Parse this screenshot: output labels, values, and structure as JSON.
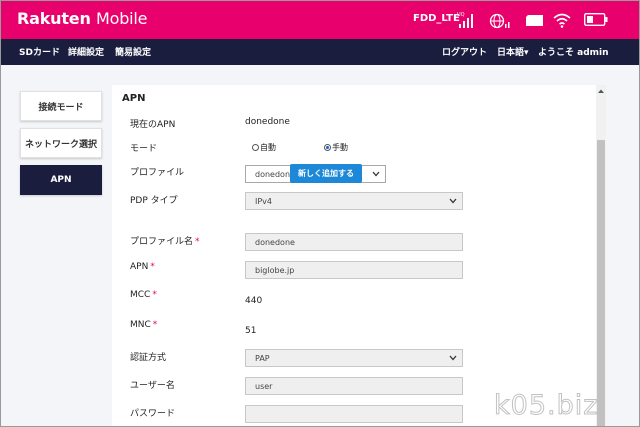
{
  "colors": {
    "brand": "#e8006d",
    "nav": "#1b1d3f",
    "accent_button": "#1e88d8",
    "required_mark": "#e8006d"
  },
  "header": {
    "logo_brand": "Rakuten",
    "logo_product": "Mobile",
    "network_status": "FDD_LTE",
    "icons": [
      "signal-bars-icon",
      "roaming-globe-icon",
      "sim-card-icon",
      "wifi-icon",
      "battery-icon"
    ]
  },
  "nav": {
    "sd_card": "SDカード",
    "advanced": "詳細設定",
    "basic": "簡易設定",
    "logout": "ログアウト",
    "language": "日本語▾",
    "welcome": "ようこそ admin"
  },
  "sidebar": {
    "items": [
      {
        "label": "接続モード",
        "active": false
      },
      {
        "label": "ネットワーク選択",
        "active": false
      },
      {
        "label": "APN",
        "active": true
      }
    ]
  },
  "apn": {
    "title": "APN",
    "current_apn_label": "現在のAPN",
    "current_apn_value": "donedone",
    "mode_label": "モード",
    "mode_auto": "自動",
    "mode_manual": "手動",
    "mode_selected": "manual",
    "profile_label": "プロファイル",
    "profile_value": "donedone",
    "add_new_button": "新しく追加する",
    "pdp_type_label": "PDP タイプ",
    "pdp_type_value": "IPv4",
    "profile_name_label": "プロファイル名",
    "profile_name_value": "donedone",
    "apn_label": "APN",
    "apn_value": "biglobe.jp",
    "mcc_label": "MCC",
    "mcc_value": "440",
    "mnc_label": "MNC",
    "mnc_value": "51",
    "auth_label": "認証方式",
    "auth_value": "PAP",
    "username_label": "ユーザー名",
    "username_value": "user",
    "password_label": "パスワード",
    "password_value": "",
    "required_mark": "*"
  },
  "watermark": "k05.biz"
}
